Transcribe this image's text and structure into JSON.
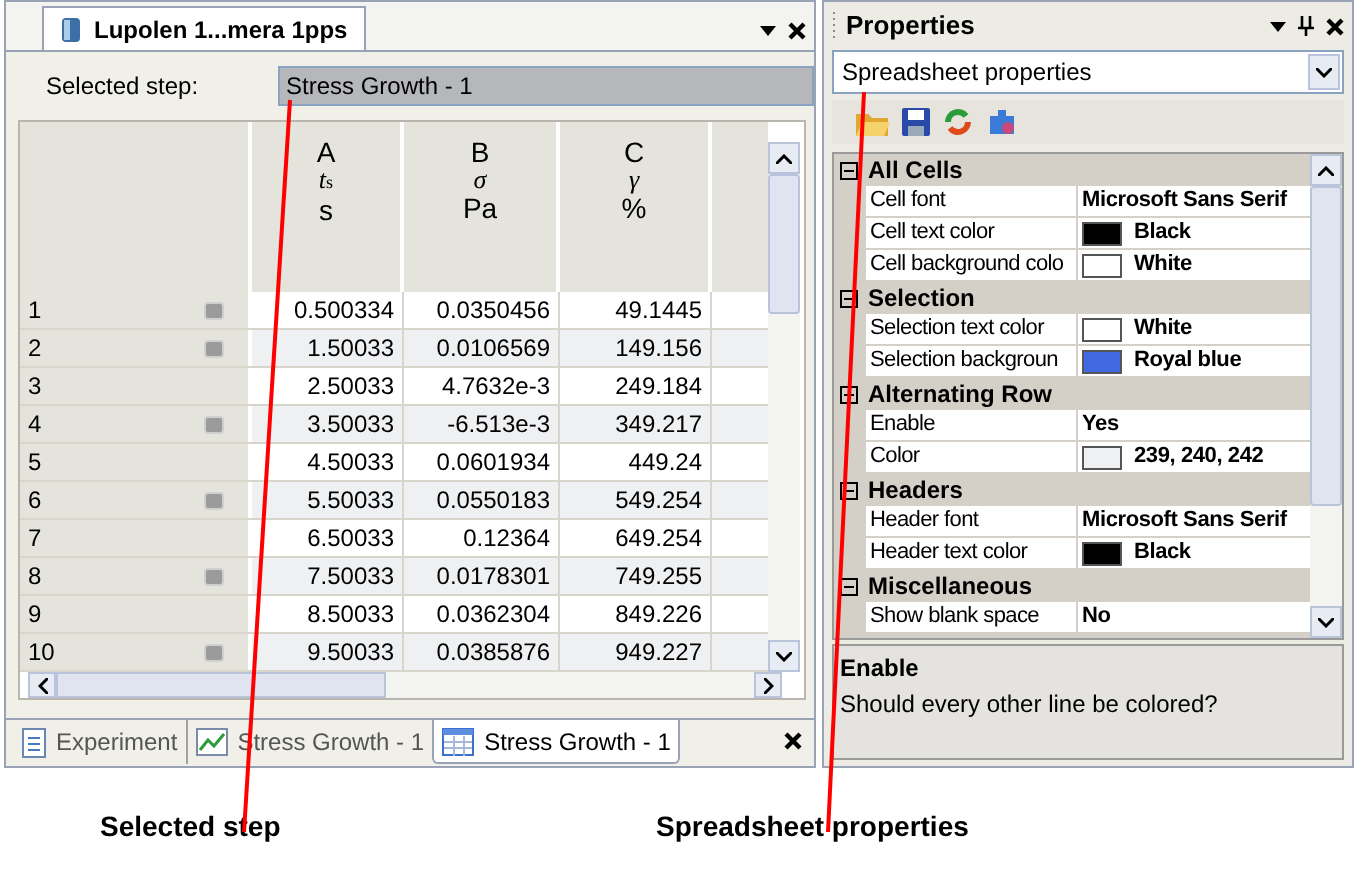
{
  "document": {
    "title": "Lupolen 1...mera 1pps",
    "selected_step_label": "Selected step:",
    "selected_step": "Stress Growth - 1",
    "columns": [
      {
        "letter": "A",
        "symbol": "t",
        "symbol_sub": "s",
        "unit": "s"
      },
      {
        "letter": "B",
        "symbol": "σ",
        "unit": "Pa"
      },
      {
        "letter": "C",
        "symbol": "γ",
        "unit": "%"
      }
    ],
    "rows": [
      {
        "number": "1",
        "flagged": true,
        "values": [
          "0.500334",
          "0.0350456",
          "49.1445"
        ]
      },
      {
        "number": "2",
        "flagged": true,
        "values": [
          "1.50033",
          "0.0106569",
          "149.156"
        ]
      },
      {
        "number": "3",
        "flagged": false,
        "values": [
          "2.50033",
          "4.7632e-3",
          "249.184"
        ]
      },
      {
        "number": "4",
        "flagged": true,
        "values": [
          "3.50033",
          "-6.513e-3",
          "349.217"
        ]
      },
      {
        "number": "5",
        "flagged": false,
        "values": [
          "4.50033",
          "0.0601934",
          "449.24"
        ]
      },
      {
        "number": "6",
        "flagged": true,
        "values": [
          "5.50033",
          "0.0550183",
          "549.254"
        ]
      },
      {
        "number": "7",
        "flagged": false,
        "values": [
          "6.50033",
          "0.12364",
          "649.254"
        ]
      },
      {
        "number": "8",
        "flagged": true,
        "values": [
          "7.50033",
          "0.0178301",
          "749.255"
        ]
      },
      {
        "number": "9",
        "flagged": false,
        "values": [
          "8.50033",
          "0.0362304",
          "849.226"
        ]
      },
      {
        "number": "10",
        "flagged": true,
        "values": [
          "9.50033",
          "0.0385876",
          "949.227"
        ]
      }
    ],
    "tabs": [
      {
        "kind": "document",
        "label": "Experiment",
        "selected": false
      },
      {
        "kind": "chart",
        "label": "Stress Growth - 1",
        "selected": false
      },
      {
        "kind": "table",
        "label": "Stress Growth - 1",
        "selected": true
      }
    ]
  },
  "properties": {
    "title": "Properties",
    "selector": "Spreadsheet properties",
    "items": [
      {
        "kind": "category",
        "name": "All Cells"
      },
      {
        "kind": "property",
        "name": "Cell font",
        "value": "Microsoft Sans Serif"
      },
      {
        "kind": "property",
        "name": "Cell text color",
        "value": "Black",
        "color": "#000000"
      },
      {
        "kind": "property",
        "name": "Cell background colo",
        "value": "White",
        "color": "#ffffff"
      },
      {
        "kind": "category",
        "name": "Selection"
      },
      {
        "kind": "property",
        "name": "Selection text color",
        "value": "White",
        "color": "#ffffff"
      },
      {
        "kind": "property",
        "name": "Selection backgroun",
        "value": "Royal blue",
        "color": "#4169e1"
      },
      {
        "kind": "category",
        "name": "Alternating Row"
      },
      {
        "kind": "property",
        "name": "Enable",
        "value": "Yes"
      },
      {
        "kind": "property",
        "name": "Color",
        "value": "239, 240, 242",
        "color": "#eff0f2"
      },
      {
        "kind": "category",
        "name": "Headers"
      },
      {
        "kind": "property",
        "name": "Header font",
        "value": "Microsoft Sans Serif"
      },
      {
        "kind": "property",
        "name": "Header text color",
        "value": "Black",
        "color": "#000000"
      },
      {
        "kind": "category",
        "name": "Miscellaneous"
      },
      {
        "kind": "property",
        "name": "Show blank space",
        "value": "No"
      }
    ],
    "description_title": "Enable",
    "description_text": "Should every other line be colored?"
  },
  "callouts": [
    "Selected step",
    "Spreadsheet properties"
  ]
}
